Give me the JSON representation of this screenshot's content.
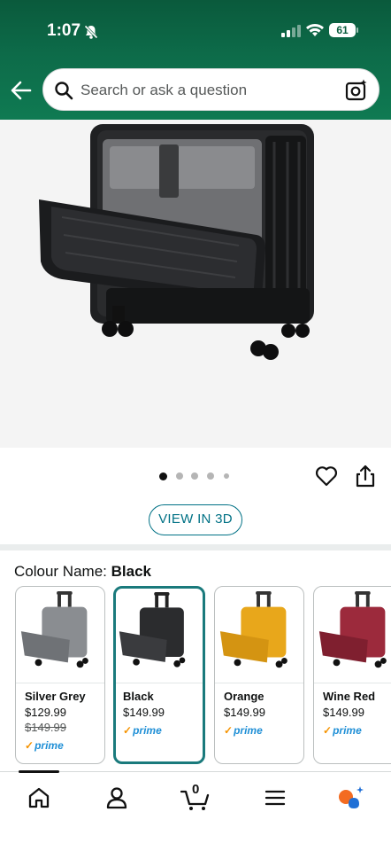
{
  "status_bar": {
    "time": "1:07",
    "battery": "61"
  },
  "search": {
    "placeholder": "Search or ask a question"
  },
  "gallery": {
    "page_count": 5,
    "active_page": 0
  },
  "view_3d_label": "VIEW IN 3D",
  "colour": {
    "label": "Colour Name: ",
    "selected": "Black"
  },
  "swatches": [
    {
      "name": "Silver Grey",
      "price": "$129.99",
      "list_price": "$149.99",
      "prime": "prime",
      "color": "#8a8d91"
    },
    {
      "name": "Black",
      "price": "$149.99",
      "list_price": "",
      "prime": "prime",
      "color": "#2b2c2e"
    },
    {
      "name": "Orange",
      "price": "$149.99",
      "list_price": "",
      "prime": "prime",
      "color": "#e8a71b"
    },
    {
      "name": "Wine Red",
      "price": "$149.99",
      "list_price": "",
      "prime": "prime",
      "color": "#9c2a3c"
    }
  ],
  "cart": {
    "count": "0"
  },
  "colors": {
    "header": "#0d6b49",
    "accent": "#007185",
    "selected_border": "#1a7a7c",
    "prime_blue": "#1f8fd6",
    "prime_check": "#f59300"
  }
}
